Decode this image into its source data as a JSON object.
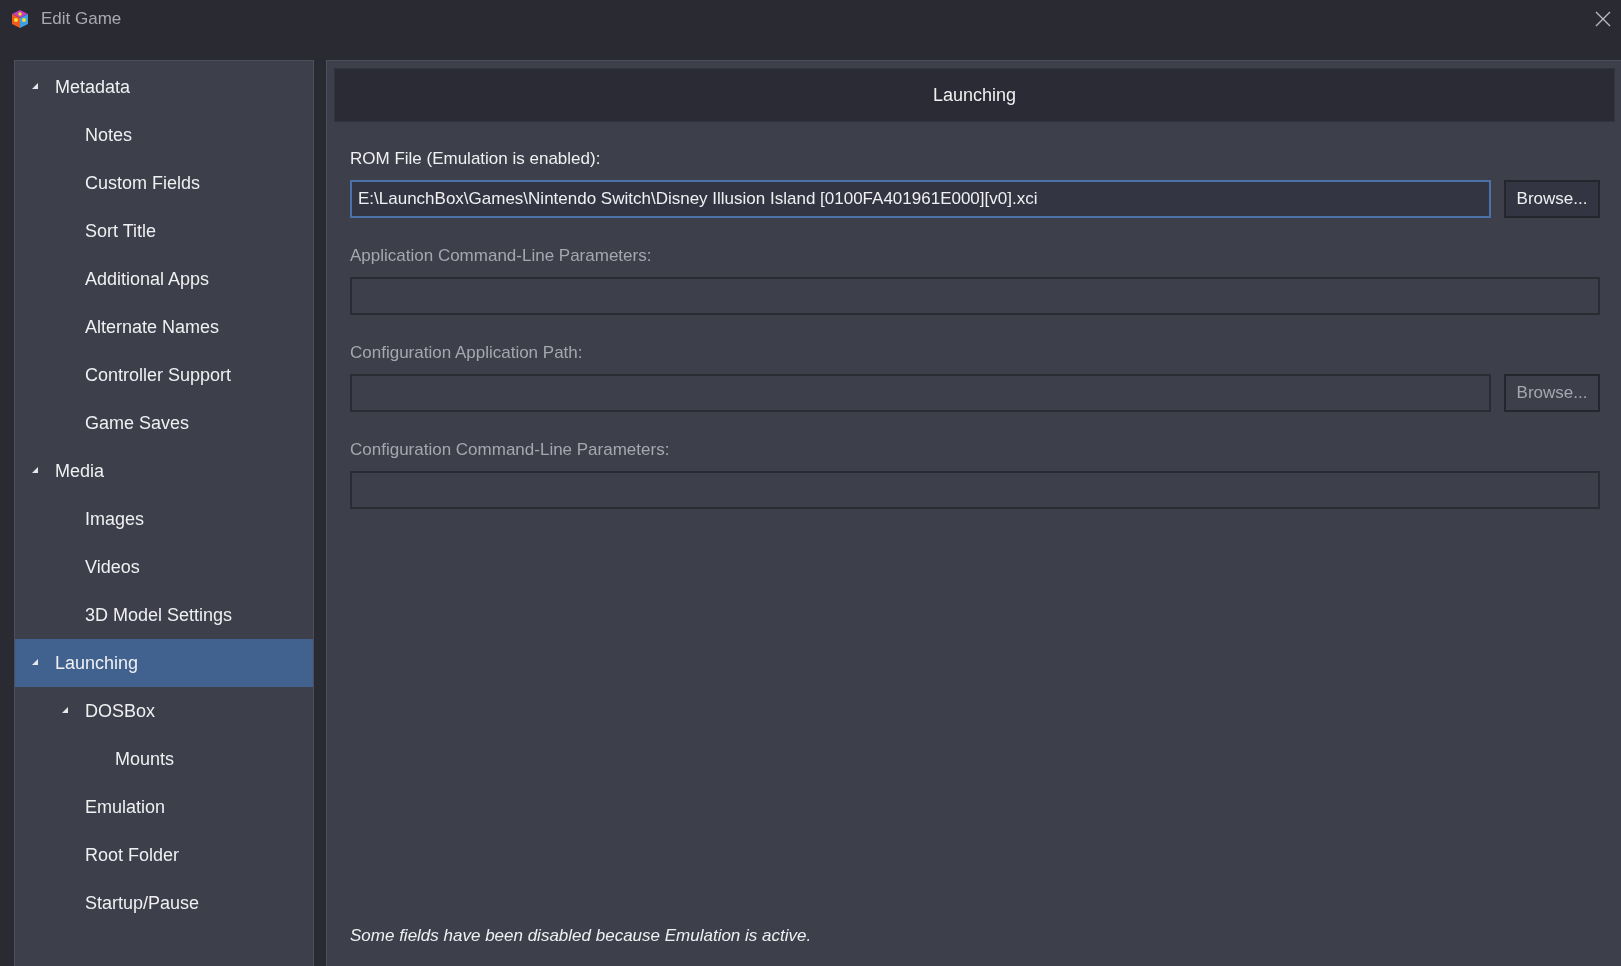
{
  "window": {
    "title": "Edit Game"
  },
  "sidebar": {
    "items": [
      {
        "label": "Metadata",
        "expanded": true,
        "selected": false,
        "children": [
          {
            "label": "Notes",
            "selected": false
          },
          {
            "label": "Custom Fields",
            "selected": false
          },
          {
            "label": "Sort Title",
            "selected": false
          },
          {
            "label": "Additional Apps",
            "selected": false
          },
          {
            "label": "Alternate Names",
            "selected": false
          },
          {
            "label": "Controller Support",
            "selected": false
          },
          {
            "label": "Game Saves",
            "selected": false
          }
        ]
      },
      {
        "label": "Media",
        "expanded": true,
        "selected": false,
        "children": [
          {
            "label": "Images",
            "selected": false
          },
          {
            "label": "Videos",
            "selected": false
          },
          {
            "label": "3D Model Settings",
            "selected": false
          }
        ]
      },
      {
        "label": "Launching",
        "expanded": true,
        "selected": true,
        "children": [
          {
            "label": "DOSBox",
            "expanded": true,
            "selected": false,
            "children": [
              {
                "label": "Mounts",
                "selected": false
              }
            ]
          },
          {
            "label": "Emulation",
            "selected": false
          },
          {
            "label": "Root Folder",
            "selected": false
          },
          {
            "label": "Startup/Pause",
            "selected": false
          }
        ]
      }
    ]
  },
  "panel": {
    "title": "Launching",
    "fields": [
      {
        "label": "ROM File (Emulation is enabled):",
        "value": "E:\\LaunchBox\\Games\\Nintendo Switch\\Disney Illusion Island [0100FA401961E000][v0].xci",
        "disabled": false,
        "focused": true,
        "button": "Browse..."
      },
      {
        "label": "Application Command-Line Parameters:",
        "disabled": true,
        "focused": false
      },
      {
        "label": "Configuration Application Path:",
        "disabled": true,
        "focused": false,
        "button": "Browse..."
      },
      {
        "label": "Configuration Command-Line Parameters:",
        "disabled": true,
        "focused": false
      }
    ],
    "note": "Some fields have been disabled because Emulation is active."
  }
}
